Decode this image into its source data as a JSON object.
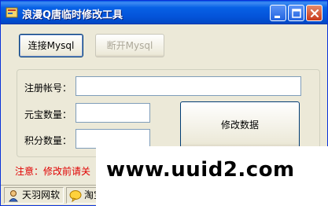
{
  "window": {
    "title": "浪漫Q唐临时修改工具",
    "icon": "app-icon",
    "controls": [
      "minimize-icon",
      "maximize-icon",
      "close-icon"
    ]
  },
  "toolbar": {
    "connect_label": "连接Mysql",
    "disconnect_label": "断开Mysql"
  },
  "form": {
    "account_label": "注册帐号：",
    "account_value": "",
    "yuanbao_label": "元宝数量：",
    "yuanbao_value": "",
    "points_label": "积分数量：",
    "points_value": "",
    "modify_label": "修改数据"
  },
  "notice": "注意：修改前请关",
  "statusbar": {
    "pane1": "天羽网软",
    "pane2": "淘宝"
  },
  "watermark": "www.uuid2.com",
  "colors": {
    "titlebar": "#0453d9",
    "notice": "#e00000",
    "window_bg": "#ece9d8"
  }
}
